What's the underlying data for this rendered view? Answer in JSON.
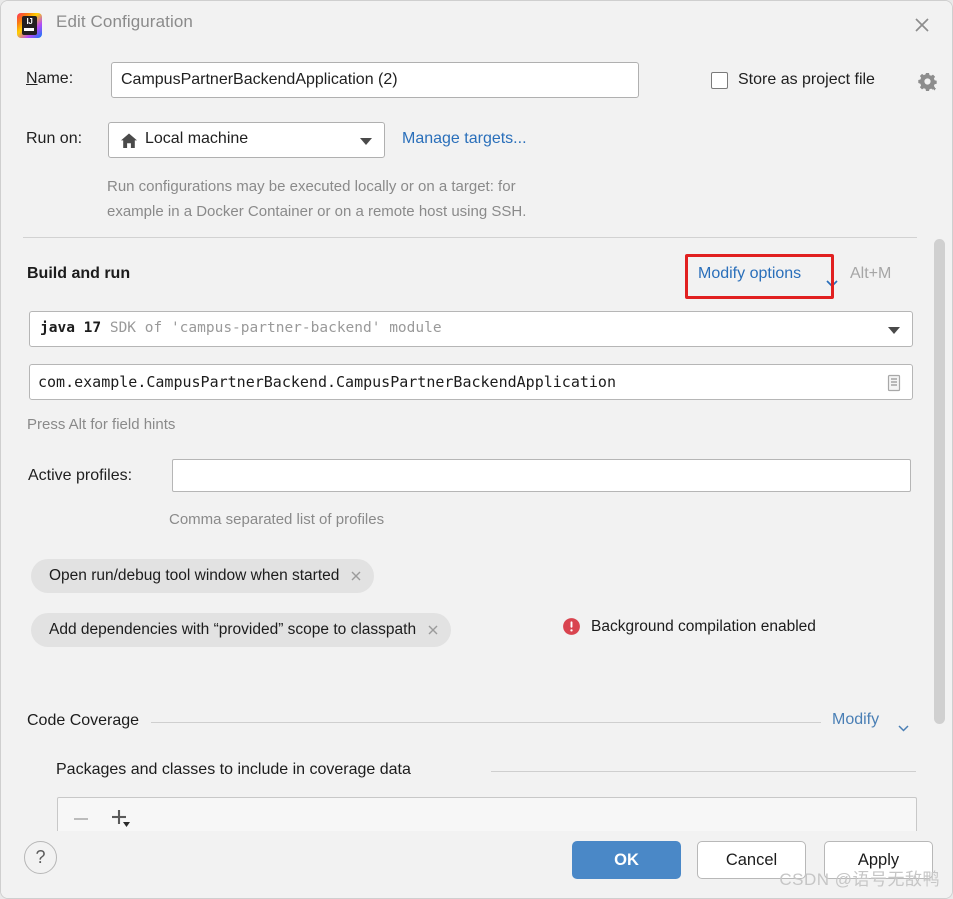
{
  "window": {
    "title": "Edit Configuration",
    "app_icon": "intellij-idea-icon",
    "close_icon": "close-icon"
  },
  "form": {
    "name_label": "Name:",
    "name_label_mnemonic": "N",
    "name_label_rest": "ame:",
    "name_value": "CampusPartnerBackendApplication (2)",
    "store_as_project_file_label": "Store as project file",
    "store_as_project_file_checked": false,
    "gear_icon": "gear-icon",
    "run_on_label": "Run on:",
    "run_on_value": "Local machine",
    "run_on_icon": "home-icon",
    "manage_targets_label": "Manage targets...",
    "hint_line_1": "Run configurations may be executed locally or on a target: for",
    "hint_line_2": "example in a Docker Container or on a remote host using SSH."
  },
  "build_and_run": {
    "section_title": "Build and run",
    "modify_options_label": "Modify options",
    "modify_options_shortcut": "Alt+M",
    "modify_options_highlight_color": "#e12020",
    "sdk_name": "java 17",
    "sdk_description": "SDK of 'campus-partner-backend' module",
    "main_class": "com.example.CampusPartnerBackend.CampusPartnerBackendApplication",
    "main_class_browse_icon": "module-list-icon",
    "field_hints": "Press Alt for field hints",
    "active_profiles_label": "Active profiles:",
    "active_profiles_value": "",
    "active_profiles_placeholder": "",
    "active_profiles_hint": "Comma separated list of profiles",
    "chips": [
      {
        "label": "Open run/debug tool window when started",
        "close_icon": "chip-close-icon"
      },
      {
        "label": "Add dependencies with “provided” scope to classpath",
        "close_icon": "chip-close-icon"
      }
    ],
    "background_compilation": {
      "icon": "error-circle-icon",
      "icon_color": "#d9444f",
      "text": "Background compilation enabled"
    }
  },
  "code_coverage": {
    "section_title": "Code Coverage",
    "modify_label": "Modify",
    "packages_title": "Packages and classes to include in coverage data",
    "remove_icon": "minus-icon",
    "add_icon": "plus-dropdown-icon"
  },
  "footer": {
    "help_label": "?",
    "ok_label": "OK",
    "cancel_label": "Cancel",
    "apply_label": "Apply",
    "ok_color": "#4a88c7"
  },
  "watermark": {
    "text": "CSDN @语号无敌鸭"
  }
}
